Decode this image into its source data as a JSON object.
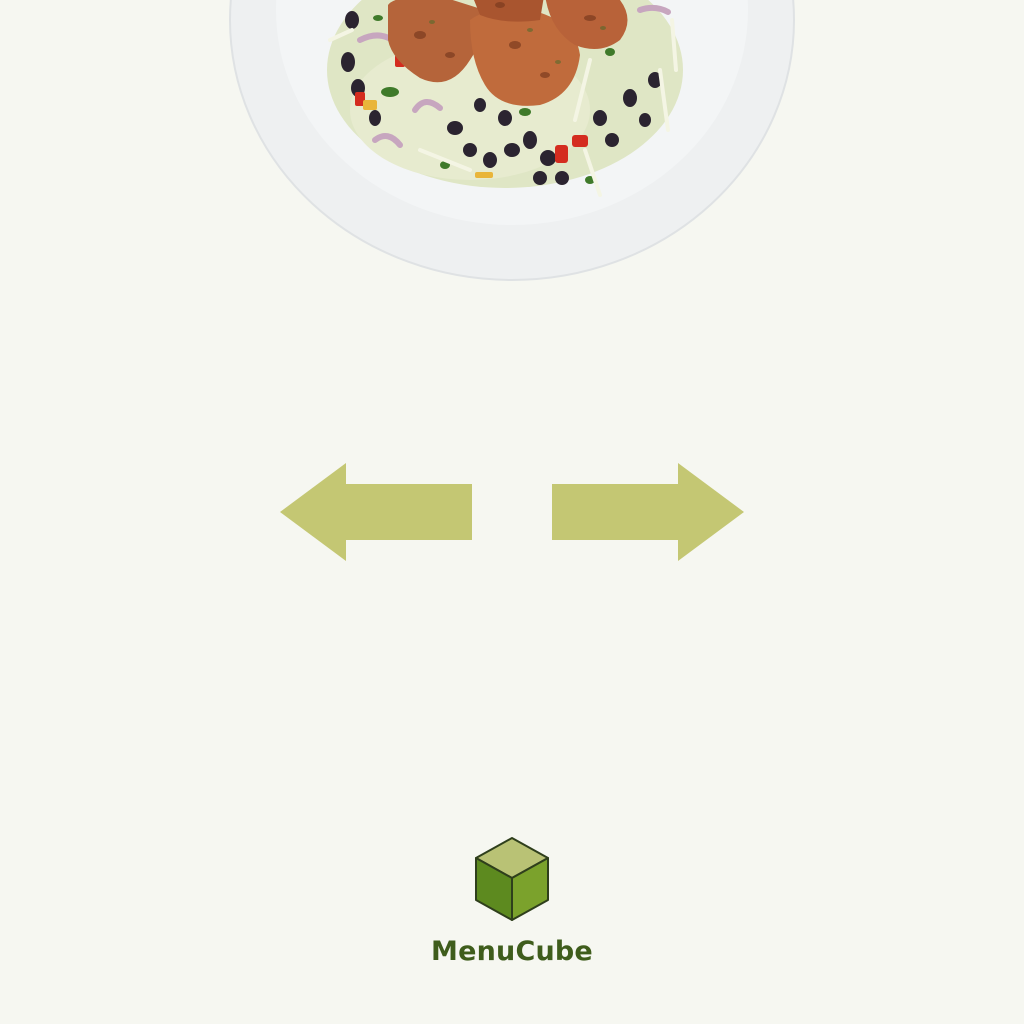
{
  "brand": {
    "name": "MenuCube",
    "colors": {
      "text": "#3f5d1c",
      "cube_top": "#b9c275",
      "cube_left": "#5d8a1f",
      "cube_right": "#7ba22c",
      "cube_outline": "#2f3f1c"
    }
  },
  "navigation": {
    "prev_icon": "arrow-left-icon",
    "next_icon": "arrow-right-icon",
    "arrow_color": "#c4c773"
  },
  "hero": {
    "image": "plate-with-chicken-black-beans-slaw"
  },
  "background": "#f6f7f1"
}
